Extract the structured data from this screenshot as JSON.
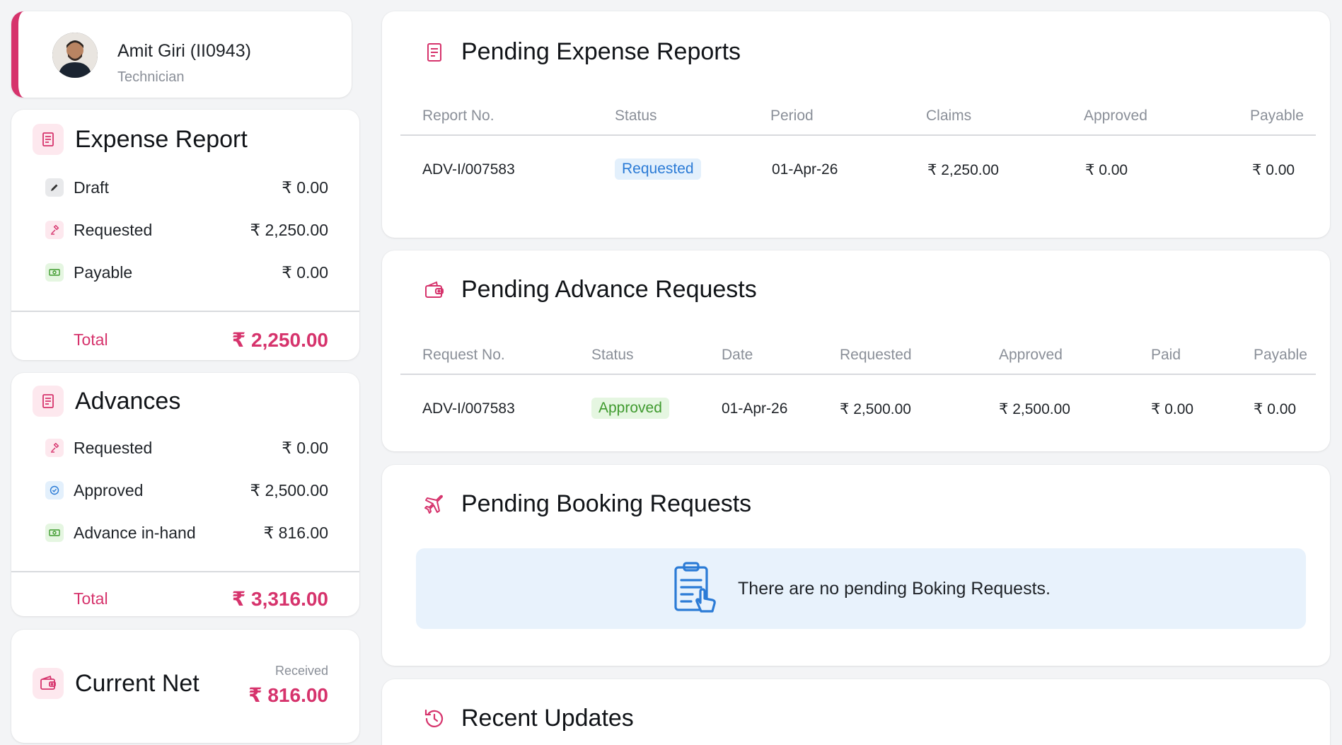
{
  "profile": {
    "name": "Amit Giri (II0943)",
    "role": "Technician"
  },
  "expense_report": {
    "title": "Expense Report",
    "items": [
      {
        "label": "Draft",
        "value": "₹ 0.00",
        "icon": "pencil-icon"
      },
      {
        "label": "Requested",
        "value": "₹ 2,250.00",
        "icon": "gavel-icon"
      },
      {
        "label": "Payable",
        "value": "₹ 0.00",
        "icon": "cash-icon"
      }
    ],
    "total_label": "Total",
    "total_value": "₹ 2,250.00"
  },
  "advances": {
    "title": "Advances",
    "items": [
      {
        "label": "Requested",
        "value": "₹ 0.00",
        "icon": "gavel-icon"
      },
      {
        "label": "Approved",
        "value": "₹ 2,500.00",
        "icon": "check-circle-icon"
      },
      {
        "label": "Advance in-hand",
        "value": "₹ 816.00",
        "icon": "cash-icon"
      }
    ],
    "total_label": "Total",
    "total_value": "₹ 3,316.00"
  },
  "current_net": {
    "title": "Current Net",
    "received_label": "Received",
    "received_value": "₹ 816.00"
  },
  "pending_expense_reports": {
    "title": "Pending Expense Reports",
    "columns": [
      "Report No.",
      "Status",
      "Period",
      "Claims",
      "Approved",
      "Payable"
    ],
    "rows": [
      {
        "report_no": "ADV-I/007583",
        "status": "Requested",
        "period": "01-Apr-26",
        "claims": "₹ 2,250.00",
        "approved": "₹ 0.00",
        "payable": "₹ 0.00"
      }
    ]
  },
  "pending_advance_requests": {
    "title": "Pending Advance Requests",
    "columns": [
      "Request No.",
      "Status",
      "Date",
      "Requested",
      "Approved",
      "Paid",
      "Payable"
    ],
    "rows": [
      {
        "request_no": "ADV-I/007583",
        "status": "Approved",
        "date": "01-Apr-26",
        "requested": "₹ 2,500.00",
        "approved": "₹ 2,500.00",
        "paid": "₹ 0.00",
        "payable": "₹ 0.00"
      }
    ]
  },
  "pending_booking_requests": {
    "title": "Pending Booking Requests",
    "empty_message": "There are no pending Boking Requests."
  },
  "recent_updates": {
    "title": "Recent Updates"
  },
  "colors": {
    "accent": "#d6336c",
    "requested_badge": "#2b7bd6",
    "approved_badge": "#3f9a2e",
    "empty_bg": "#e8f2fc"
  }
}
